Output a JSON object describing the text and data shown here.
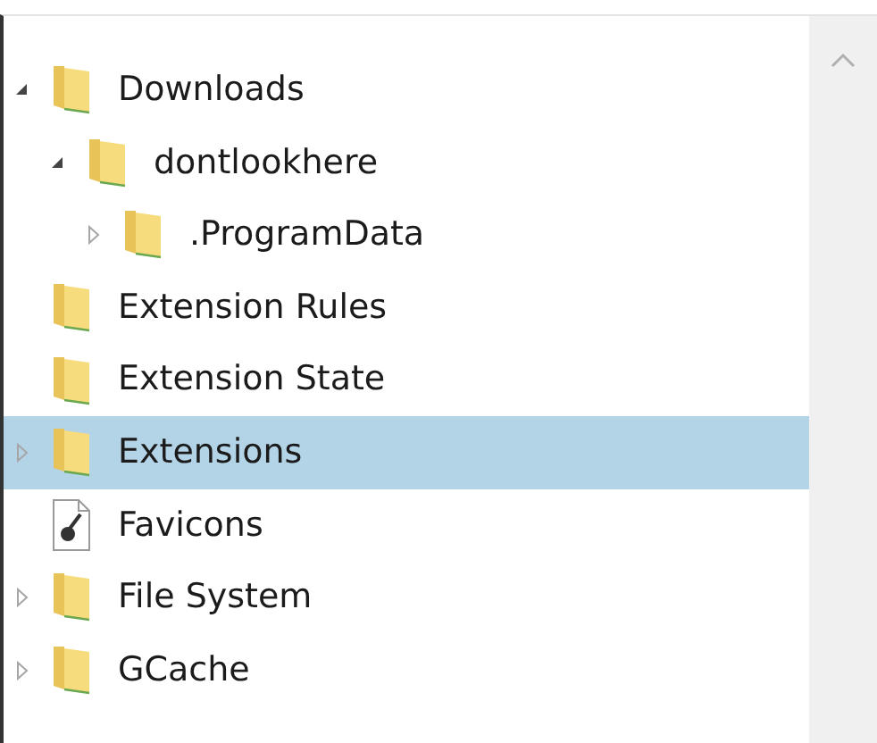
{
  "tree": [
    {
      "label": "Downloads",
      "kind": "folder",
      "expanded": true,
      "selected": false,
      "children": [
        {
          "label": "dontlookhere",
          "kind": "folder",
          "expanded": true,
          "selected": false,
          "children": [
            {
              "label": ".ProgramData",
              "kind": "folder",
              "expanded": false,
              "selected": false
            }
          ]
        }
      ]
    },
    {
      "label": "Extension Rules",
      "kind": "folder",
      "selected": false
    },
    {
      "label": "Extension State",
      "kind": "folder",
      "selected": false
    },
    {
      "label": "Extensions",
      "kind": "folder",
      "expanded": false,
      "selected": true
    },
    {
      "label": "Favicons",
      "kind": "file",
      "selected": false
    },
    {
      "label": "File System",
      "kind": "folder",
      "expanded": false,
      "selected": false
    },
    {
      "label": "GCache",
      "kind": "folder",
      "expanded": false,
      "selected": false
    }
  ]
}
